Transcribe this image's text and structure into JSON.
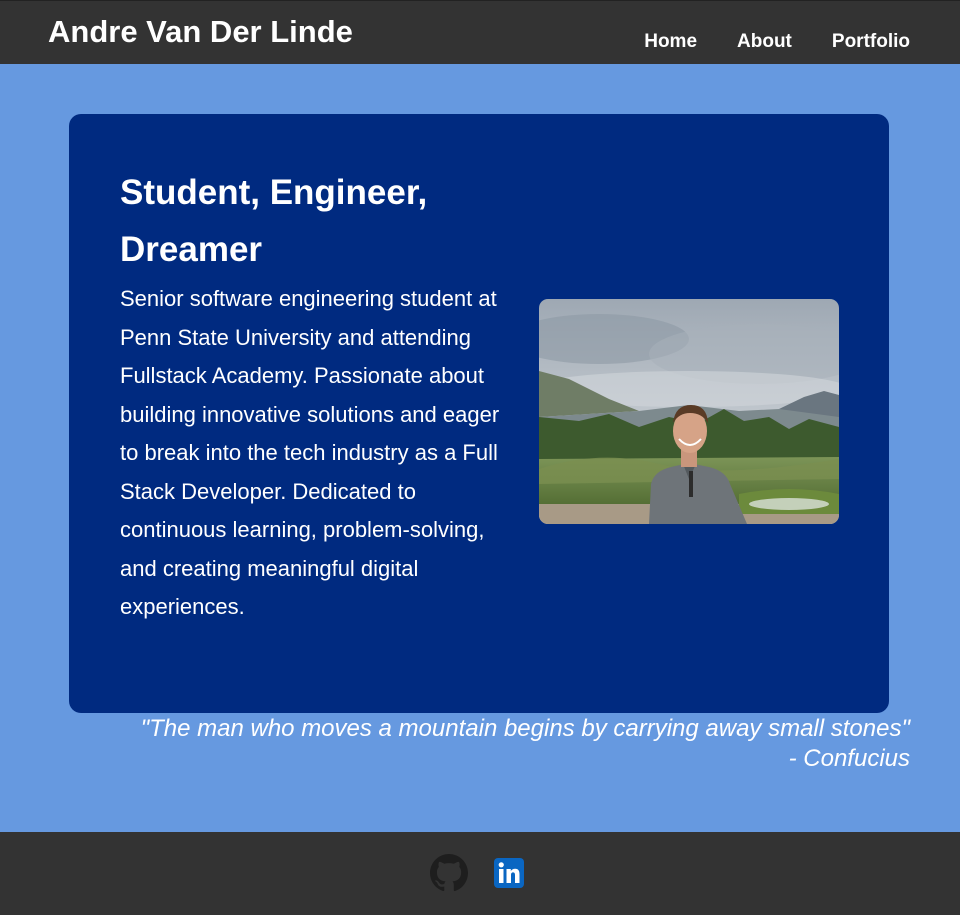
{
  "header": {
    "site_title": "Andre Van Der Linde",
    "nav": [
      {
        "label": "Home"
      },
      {
        "label": "About"
      },
      {
        "label": "Portfolio"
      }
    ]
  },
  "hero": {
    "headline": "Student, Engineer, Dreamer",
    "bio": "Senior software engineering student at Penn State University and attending Fullstack Academy. Passionate about building innovative solutions and eager to break into the tech industry as a Full Stack Developer. Dedicated to continuous learning, problem-solving, and creating meaningful digital experiences.",
    "photo_icon": "profile-photo"
  },
  "quote": {
    "text": "\"The man who moves a mountain begins by carrying away small stones\"",
    "author": "- Confucius"
  },
  "footer": {
    "links": [
      {
        "icon": "github-icon"
      },
      {
        "icon": "linkedin-icon"
      }
    ]
  },
  "colors": {
    "background": "#6699e0",
    "bar": "#333333",
    "card": "#002a80",
    "linkedin": "#0a66c2",
    "github": "#1e1e1e"
  }
}
